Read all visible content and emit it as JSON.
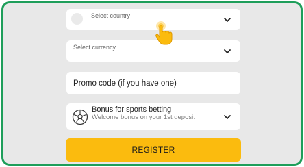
{
  "form": {
    "country": {
      "placeholder": "Select country",
      "icon": "chevron-down-icon"
    },
    "currency": {
      "placeholder": "Select currency",
      "icon": "chevron-down-icon"
    },
    "promo": {
      "placeholder": "Promo code (if you have one)"
    },
    "bonus": {
      "title": "Bonus for sports betting",
      "subtitle": "Welcome bonus on your 1st deposit",
      "icon": "soccer-ball-icon"
    },
    "register_label": "REGISTER"
  },
  "colors": {
    "frame_border": "#1e9e5a",
    "background": "#e8e8e8",
    "accent": "#fbbb0e"
  }
}
